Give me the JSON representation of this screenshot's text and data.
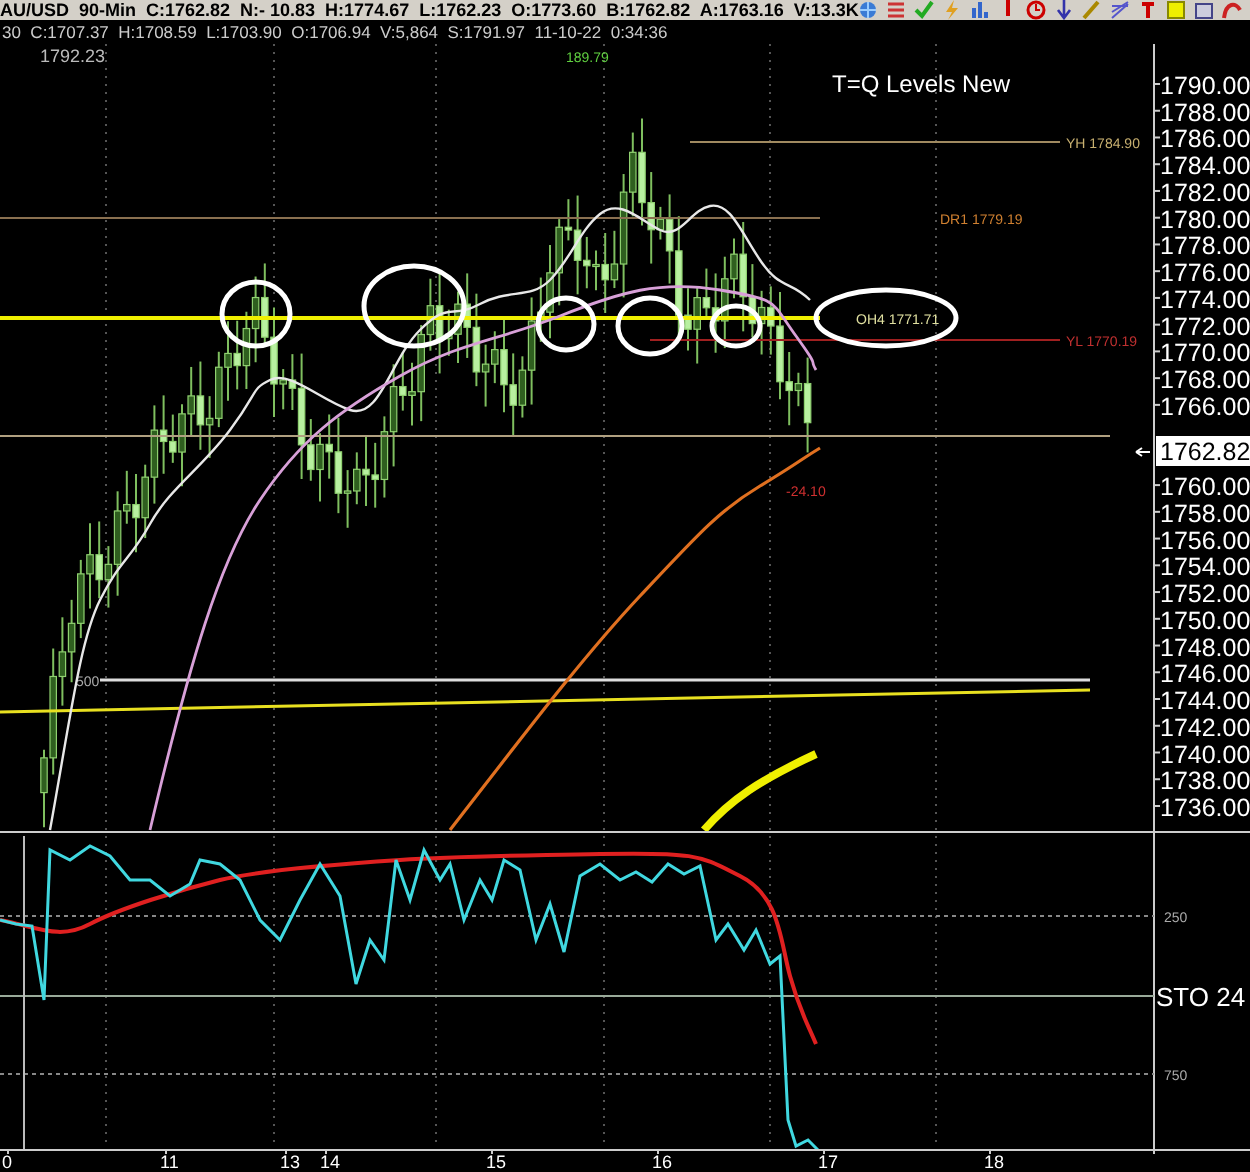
{
  "quote_bar": {
    "text": "AU/USD  90-Min  C:1762.82  N:- 10.83  H:1774.67  L:1762.23  O:1773.60  B:1762.82  A:1763.16  V:13.3K"
  },
  "info_line": {
    "text": "30  C:1707.37  H:1708.59  L:1703.90  O:1706.94  V:5,864  S:1791.97  11-10-22  0:34:36"
  },
  "chart": {
    "corner_value": "1792.23",
    "title": "T=Q Levels New",
    "peak_label": "189.79",
    "levels": [
      {
        "label": "YH 1784.90",
        "kind": "yesterday-high"
      },
      {
        "label": "DR1 1779.19",
        "kind": "pivot"
      },
      {
        "label": "OH4 1771.71",
        "kind": "open"
      },
      {
        "label": "YL 1770.19",
        "kind": "yesterday-low"
      }
    ],
    "change_label": "-24.10",
    "fib_label": "500",
    "price_axis_upper": [
      "1790.00",
      "1788.00",
      "1786.00",
      "1784.00",
      "1782.00",
      "1780.00",
      "1778.00",
      "1776.00",
      "1774.00",
      "1772.00",
      "1770.00",
      "1768.00",
      "1766.00"
    ],
    "last_price": "1762.82",
    "price_axis_lower": [
      "1760.00",
      "1758.00",
      "1756.00",
      "1754.00",
      "1752.00",
      "1750.00",
      "1748.00",
      "1746.00",
      "1744.00",
      "1742.00",
      "1740.00",
      "1738.00",
      "1736.00"
    ]
  },
  "oscillator": {
    "name": "STO 24",
    "axis": [
      "250",
      "750"
    ]
  },
  "time_axis": [
    "0",
    "11",
    "13",
    "14",
    "15",
    "16",
    "17",
    "18"
  ]
}
